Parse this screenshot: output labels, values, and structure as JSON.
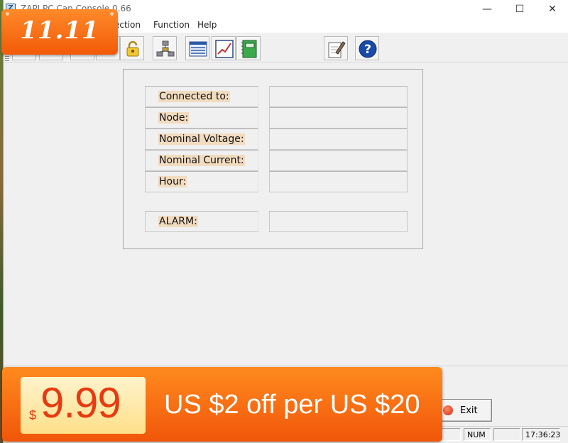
{
  "window": {
    "title": "ZAPI PC Can Console 0.66",
    "icon_letter": "Z",
    "minimize_glyph": "—",
    "maximize_glyph": "☐",
    "close_glyph": "✕"
  },
  "menu": {
    "items": [
      "ection",
      "Function",
      "Help"
    ]
  },
  "toolbar": {
    "buttons": [
      "unlock-icon",
      "network-nodes-icon",
      "data-list-icon",
      "chart-icon",
      "notebook-icon",
      "edit-document-icon",
      "help-icon"
    ]
  },
  "info_panel": {
    "rows": [
      {
        "label": "Connected to:",
        "value": ""
      },
      {
        "label": "Node:",
        "value": ""
      },
      {
        "label": "Nominal Voltage:",
        "value": ""
      },
      {
        "label": "Nominal Current:",
        "value": ""
      },
      {
        "label": "Hour:",
        "value": ""
      }
    ],
    "alarm": {
      "label": "ALARM:",
      "value": ""
    }
  },
  "actions": {
    "exit_label": "Exit"
  },
  "statusbar": {
    "num": "NUM",
    "time": "17:36:23"
  },
  "promo": {
    "badge_text": "11.11",
    "currency_symbol": "$",
    "price": "9.99",
    "offer_text": "US $2 off per US $20"
  },
  "colors": {
    "label_highlight": "#f2dcc0",
    "promo_orange": "#f25a08",
    "price_red": "#e83a10"
  }
}
